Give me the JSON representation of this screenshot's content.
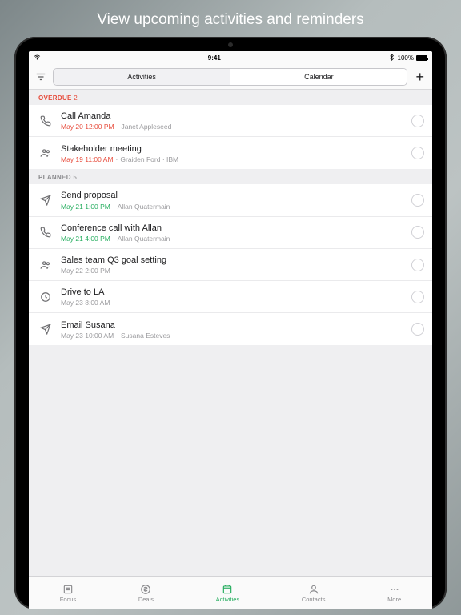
{
  "promo_title": "View upcoming activities and reminders",
  "statusbar": {
    "time": "9:41",
    "battery": "100%"
  },
  "toolbar": {
    "segments": {
      "a": "Activities",
      "b": "Calendar"
    }
  },
  "sections": {
    "overdue": {
      "label": "OVERDUE",
      "count": "2"
    },
    "planned": {
      "label": "PLANNED",
      "count": "5"
    }
  },
  "activities": {
    "overdue": [
      {
        "icon": "phone",
        "title": "Call Amanda",
        "datetime": "May 20 12:00 PM",
        "dt_color": "red",
        "subject": "Janet Appleseed"
      },
      {
        "icon": "people",
        "title": "Stakeholder meeting",
        "datetime": "May 19 11:00 AM",
        "dt_color": "red",
        "subject": "Graiden Ford · IBM"
      }
    ],
    "planned": [
      {
        "icon": "send",
        "title": "Send proposal",
        "datetime": "May 21 1:00 PM",
        "dt_color": "green",
        "subject": "Allan Quatermain"
      },
      {
        "icon": "phone",
        "title": "Conference call with Allan",
        "datetime": "May 21 4:00 PM",
        "dt_color": "green",
        "subject": "Allan Quatermain"
      },
      {
        "icon": "people",
        "title": "Sales team Q3 goal setting",
        "datetime": "May 22 2:00 PM",
        "dt_color": "",
        "subject": ""
      },
      {
        "icon": "clock",
        "title": "Drive to LA",
        "datetime": "May 23 8:00 AM",
        "dt_color": "",
        "subject": ""
      },
      {
        "icon": "send",
        "title": "Email Susana",
        "datetime": "May 23 10:00 AM",
        "dt_color": "",
        "subject": "Susana Esteves"
      }
    ]
  },
  "tabs": {
    "focus": "Focus",
    "deals": "Deals",
    "activities": "Activities",
    "contacts": "Contacts",
    "more": "More"
  },
  "colors": {
    "accent": "#27ae60",
    "danger": "#e74c3c"
  }
}
